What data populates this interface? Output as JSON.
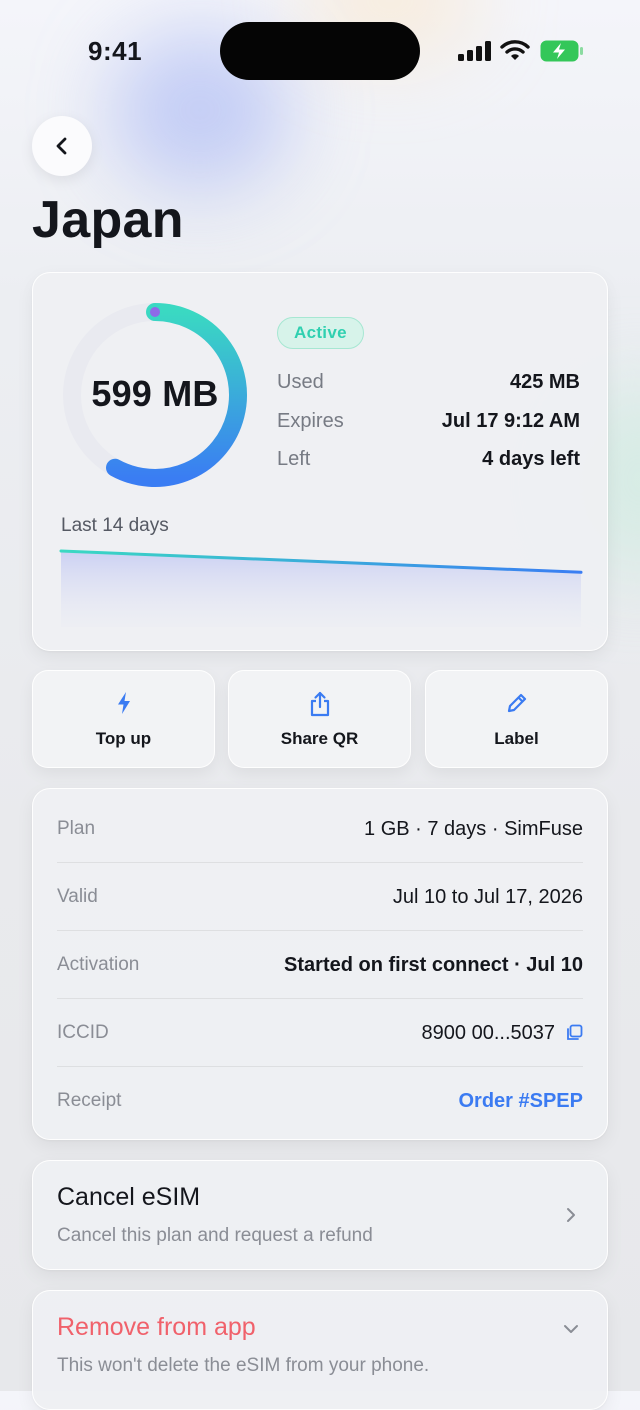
{
  "status_bar": {
    "time": "9:41"
  },
  "header": {
    "title": "Japan"
  },
  "usage": {
    "remaining": "599 MB",
    "status_badge": "Active",
    "used_fraction": 0.42,
    "stats": [
      {
        "label": "Used",
        "value": "425 MB"
      },
      {
        "label": "Expires",
        "value": "Jul 17 9:12 AM"
      },
      {
        "label": "Left",
        "value": "4 days left"
      }
    ],
    "history_label": "Last 14 days",
    "history_trend": {
      "start": 1.0,
      "end": 0.44
    }
  },
  "actions": [
    {
      "label": "Top up",
      "icon": "bolt-icon"
    },
    {
      "label": "Share QR",
      "icon": "share-icon"
    },
    {
      "label": "Label",
      "icon": "pencil-icon"
    }
  ],
  "details": [
    {
      "label": "Plan",
      "value": "1 GB · 7 days · SimFuse"
    },
    {
      "label": "Valid",
      "value": "Jul 10 to Jul 17, 2026"
    },
    {
      "label": "Activation",
      "value": "Started on first connect · Jul 10"
    },
    {
      "label": "ICCID",
      "value": "8900 00...5037"
    },
    {
      "label": "Receipt",
      "value": "Order #SPEP"
    }
  ],
  "cancel": {
    "title": "Cancel eSIM",
    "subtitle": "Cancel this plan and request a refund"
  },
  "remove": {
    "title": "Remove from app",
    "subtitle": "This won't delete the eSIM from your phone."
  },
  "colors": {
    "accent_teal": "#2fd0b0",
    "accent_blue": "#3b7bf2",
    "danger": "#f0616b",
    "battery": "#34c759"
  }
}
